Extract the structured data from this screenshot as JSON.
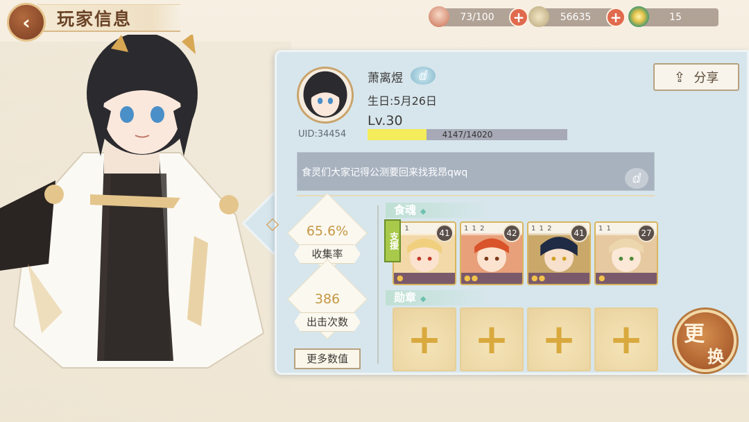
{
  "header": {
    "title": "玩家信息",
    "back_icon": "‹"
  },
  "resources": [
    {
      "name": "stamina",
      "icon": "bowl-icon",
      "value": "73/100"
    },
    {
      "name": "coins",
      "icon": "coin-icon",
      "value": "56635"
    },
    {
      "name": "diamonds",
      "icon": "disc-icon",
      "value": "15"
    }
  ],
  "profile": {
    "name": "萧离煜",
    "birthday": "生日:5月26日",
    "level": "Lv.30",
    "uid": "UID:34454",
    "exp_text": "4147/14020",
    "exp_current": 4147,
    "exp_max": 14020
  },
  "share_label": "分享",
  "signature": "食灵们大家记得公测要回来找我昂qwq",
  "stats": {
    "collection_rate": "65.6%",
    "collection_label": "收集率",
    "sorties": "386",
    "sorties_label": "出击次数",
    "more_label": "更多数值"
  },
  "food_souls": {
    "title": "食魂",
    "support_tag": "支援",
    "cards": [
      {
        "level": "41",
        "top_marks": "1 1",
        "stars": 1
      },
      {
        "level": "42",
        "top_marks": "1 1 2",
        "stars": 2
      },
      {
        "level": "41",
        "top_marks": "1 1 2",
        "stars": 2
      },
      {
        "level": "27",
        "top_marks": "1 1",
        "stars": 1
      }
    ]
  },
  "medals": {
    "title": "勋章",
    "slots": 4,
    "plus": "+"
  },
  "change_button": {
    "line1": "更",
    "line2": "换"
  },
  "colors": {
    "accent": "#c49744",
    "panel": "#d7e6ec",
    "plus": "#e06a4e",
    "xp_fill": "#f4ec5a"
  }
}
